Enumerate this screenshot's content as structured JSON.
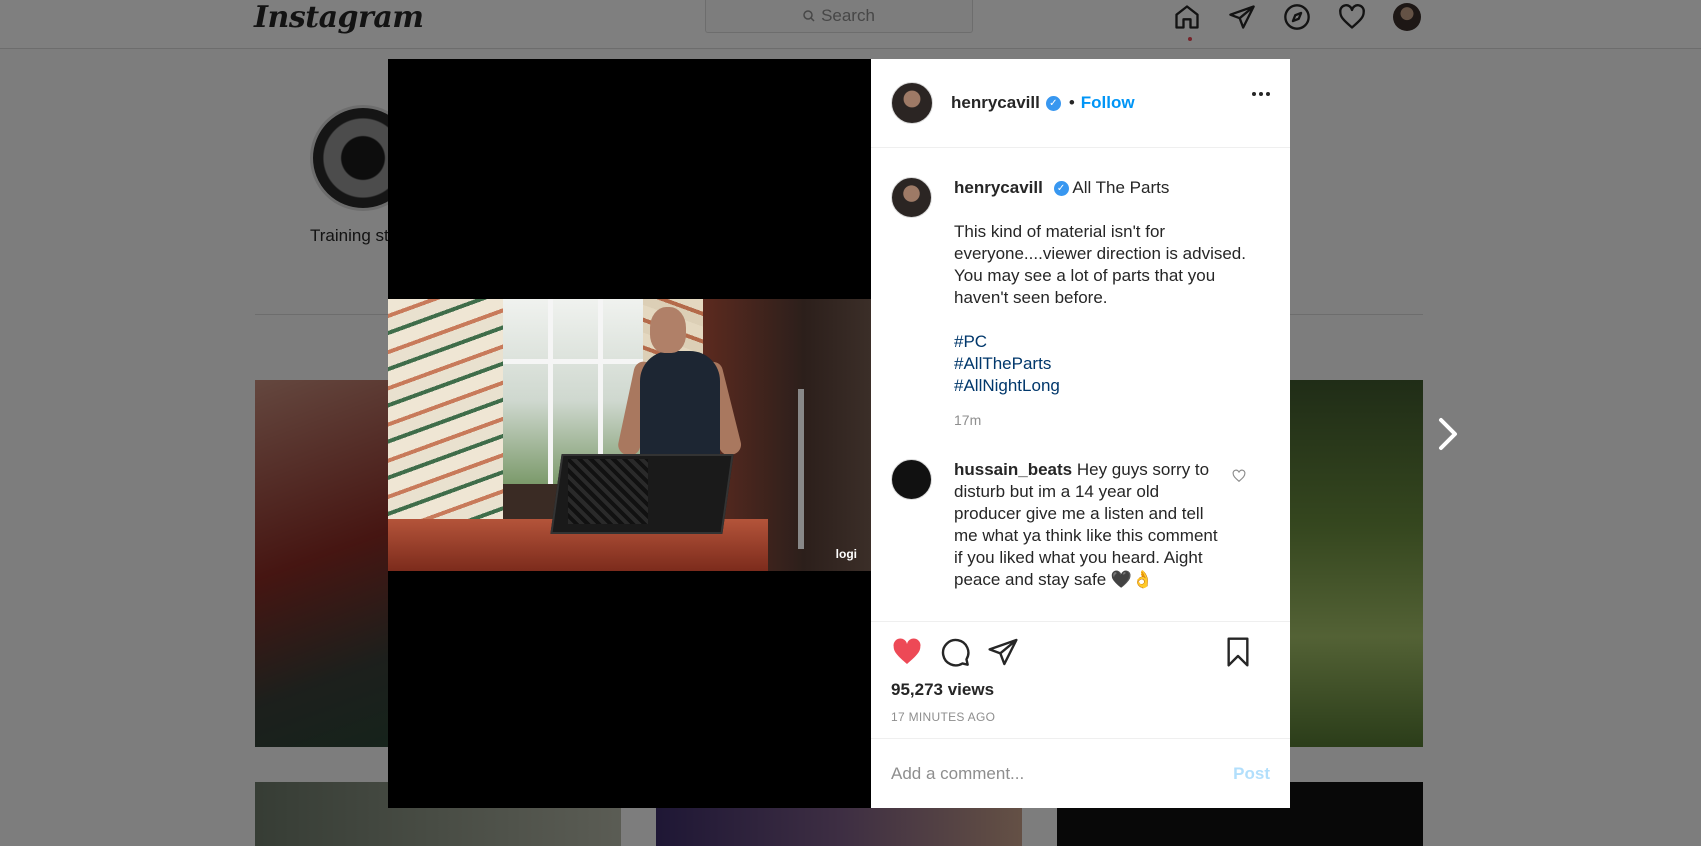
{
  "nav": {
    "logo": "Instagram",
    "search_placeholder": "Search"
  },
  "background": {
    "highlight_label": "Training st"
  },
  "video": {
    "watermark": "logi"
  },
  "post": {
    "username": "henrycavill",
    "verified_mark": "✓",
    "separator": "•",
    "follow_label": "Follow",
    "caption": {
      "username": "henrycavill",
      "title": "All The Parts",
      "body": "This kind of material isn't for everyone....viewer direction is advised. You may see a lot of parts that you haven't seen before.",
      "hashtags": [
        "#PC",
        "#AllTheParts",
        "#AllNightLong"
      ],
      "time": "17m"
    },
    "comments": [
      {
        "username": "hussain_beats",
        "text": "Hey guys sorry to disturb but im a 14 year old producer give me a listen and tell me what ya think like this comment if you liked what you heard. Aight peace and stay safe 🖤👌"
      }
    ],
    "views": "95,273 views",
    "time_ago": "17 MINUTES AGO",
    "comment_placeholder": "Add a comment...",
    "post_label": "Post"
  },
  "colors": {
    "accent": "#0095f6",
    "like": "#ed4956",
    "hashtag": "#00376b",
    "post_disabled": "#b2dffc"
  },
  "icons": {
    "home": "home-icon",
    "direct": "direct-icon",
    "explore": "explore-icon",
    "activity": "heart-icon",
    "like": "heart-filled-icon",
    "comment": "comment-icon",
    "share": "share-icon",
    "save": "bookmark-icon",
    "more": "more-icon",
    "next": "chevron-right-icon"
  }
}
